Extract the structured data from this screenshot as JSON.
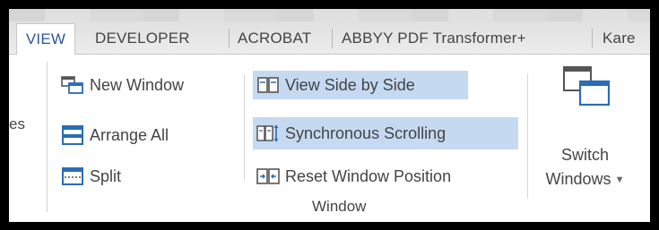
{
  "tabs": [
    {
      "label": "VIEW",
      "active": true
    },
    {
      "label": "DEVELOPER",
      "active": false
    },
    {
      "label": "ACROBAT",
      "active": false
    },
    {
      "label": "ABBYY PDF Transformer+",
      "active": false
    },
    {
      "label": "Kare",
      "active": false
    }
  ],
  "ribbon": {
    "cut_label": "es",
    "left_commands": [
      {
        "label": "New Window",
        "icon": "new-window-icon"
      },
      {
        "label": "Arrange All",
        "icon": "arrange-all-icon"
      },
      {
        "label": "Split",
        "icon": "split-icon"
      }
    ],
    "middle_commands": [
      {
        "label": "View Side by Side",
        "icon": "view-side-by-side-icon",
        "highlighted": true
      },
      {
        "label": "Synchronous Scrolling",
        "icon": "synchronous-scrolling-icon",
        "highlighted": true
      },
      {
        "label": "Reset Window Position",
        "icon": "reset-window-position-icon",
        "highlighted": false
      }
    ],
    "switch_windows": {
      "line1": "Switch",
      "line2": "Windows",
      "icon": "switch-windows-icon"
    },
    "group_label": "Window"
  },
  "colors": {
    "accent": "#2b579a",
    "highlight": "#c5d9f1",
    "icon_blue": "#2b6cb5"
  }
}
